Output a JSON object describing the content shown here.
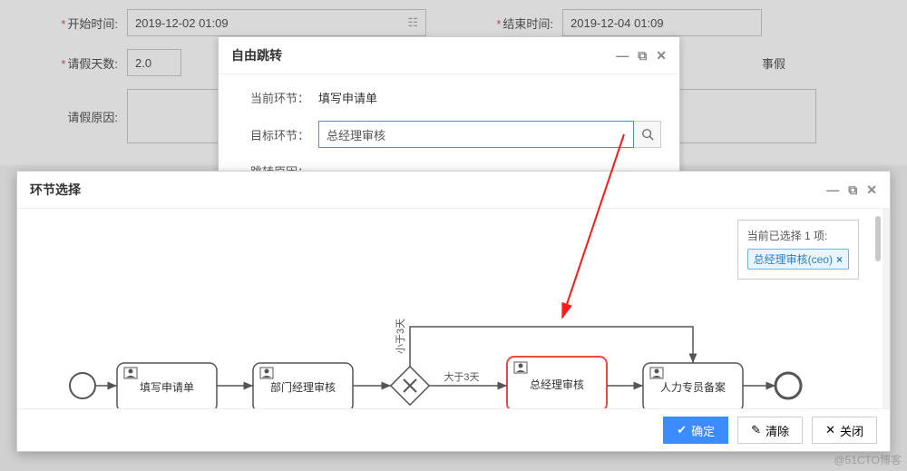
{
  "form": {
    "start_label": "开始时间:",
    "start_value": "2019-12-02 01:09",
    "end_label": "结束时间:",
    "end_value": "2019-12-04 01:09",
    "days_label": "请假天数:",
    "days_value": "2.0",
    "type_value": "事假",
    "reason_label": "请假原因:"
  },
  "jump_dialog": {
    "title": "自由跳转",
    "current_label": "当前环节：",
    "current_value": "填写申请单",
    "target_label": "目标环节：",
    "target_value": "总经理审核",
    "reason_label": "跳转原因："
  },
  "node_dialog": {
    "title": "环节选择",
    "sel_title_prefix": "当前已选择",
    "sel_count": "1",
    "sel_title_suffix": "项:",
    "sel_tag": "总经理审核(ceo)",
    "flow": {
      "task1": "填写申请单",
      "task2": "部门经理审核",
      "task3": "总经理审核",
      "task4": "人力专员备案",
      "gw_lt": "小于3天",
      "gw_gt": "大于3天"
    },
    "btn_ok": "确定",
    "btn_clear": "清除",
    "btn_close": "关闭"
  },
  "watermark": "@51CTO博客"
}
